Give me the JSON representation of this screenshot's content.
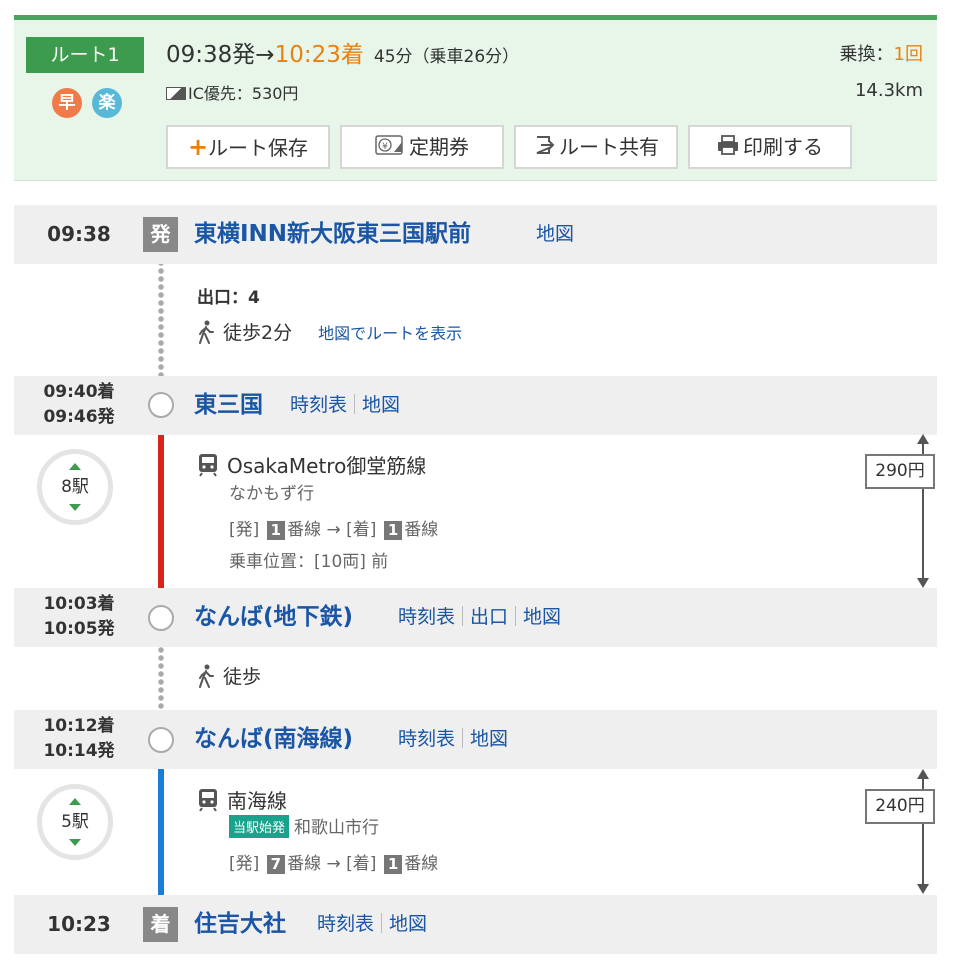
{
  "summary": {
    "route_label": "ルート1",
    "tag_fast": "早",
    "tag_easy": "楽",
    "dep_time": "09:38発",
    "arrow": "→",
    "arr_time": "10:23着",
    "duration": "45分（乗車26分）",
    "fare_label": "IC優先：530円",
    "transfer_label": "乗換：",
    "transfer_count": "1回",
    "distance": "14.3km"
  },
  "actions": {
    "save": "ルート保存",
    "commuter": "定期券",
    "share": "ルート共有",
    "print": "印刷する"
  },
  "colors": {
    "accent_green": "#3d9b4e",
    "arrival_orange": "#e8810f",
    "midosuji_red": "#d9241b",
    "nankai_blue": "#1a7ed8"
  },
  "stations": {
    "origin": {
      "time": "09:38",
      "badge": "発",
      "name": "東横INN新大阪東三国駅前",
      "map": "地図"
    },
    "higashimikuni": {
      "arr": "09:40着",
      "dep": "09:46発",
      "name": "東三国",
      "timetable": "時刻表",
      "map": "地図"
    },
    "namba_metro": {
      "arr": "10:03着",
      "dep": "10:05発",
      "name": "なんば(地下鉄)",
      "timetable": "時刻表",
      "exit": "出口",
      "map": "地図"
    },
    "namba_nankai": {
      "arr": "10:12着",
      "dep": "10:14発",
      "name": "なんば(南海線)",
      "timetable": "時刻表",
      "map": "地図"
    },
    "dest": {
      "time": "10:23",
      "badge": "着",
      "name": "住吉大社",
      "timetable": "時刻表",
      "map": "地図"
    }
  },
  "walk1": {
    "exit": "出口：4",
    "label": "徒歩2分",
    "map_link": "地図でルートを表示"
  },
  "walk2": {
    "label": "徒歩"
  },
  "segment1": {
    "stops": "8駅",
    "line": "OsakaMetro御堂筋線",
    "direction": "なかもず行",
    "dep_label": "[発]",
    "dep_platform": "1",
    "track": "番線",
    "arrow": "→",
    "arr_label": "[着]",
    "arr_platform": "1",
    "boarding": "乗車位置：[10両] 前",
    "fare": "290円"
  },
  "segment2": {
    "stops": "5駅",
    "line": "南海線",
    "origin_tag": "当駅始発",
    "direction": "和歌山市行",
    "dep_label": "[発]",
    "dep_platform": "7",
    "track": "番線",
    "arrow": "→",
    "arr_label": "[着]",
    "arr_platform": "1",
    "fare": "240円"
  }
}
